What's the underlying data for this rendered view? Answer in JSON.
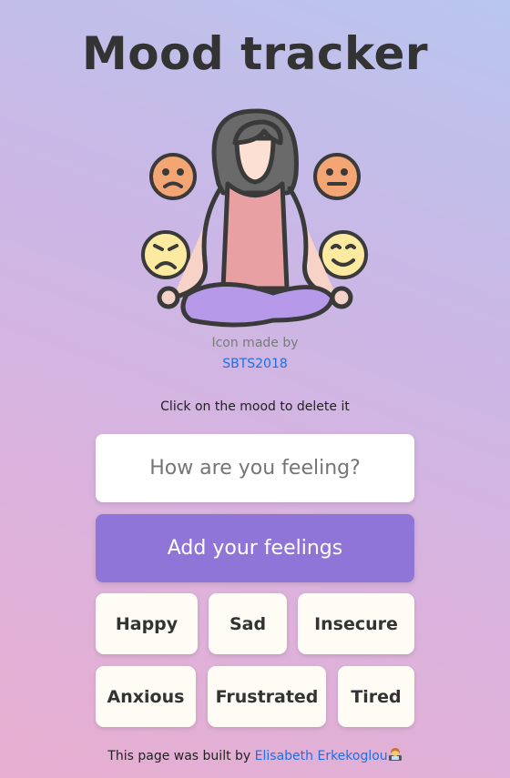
{
  "header": {
    "title": "Mood tracker"
  },
  "credit": {
    "text": "Icon made by",
    "author": "SBTS2018"
  },
  "hint": "Click on the mood to delete it",
  "form": {
    "placeholder": "How are you feeling?",
    "value": "",
    "add_label": "Add your feelings"
  },
  "moods": [
    "Happy",
    "Sad",
    "Insecure",
    "Anxious",
    "Frustrated",
    "Tired"
  ],
  "footer": {
    "prefix": "This page was built by",
    "author": "Elisabeth Erkekoglou",
    "emoji": "woman-technologist-icon"
  },
  "colors": {
    "accent": "#9075d9",
    "link": "#1f6fe0",
    "mood_card": "#fefcf5"
  }
}
